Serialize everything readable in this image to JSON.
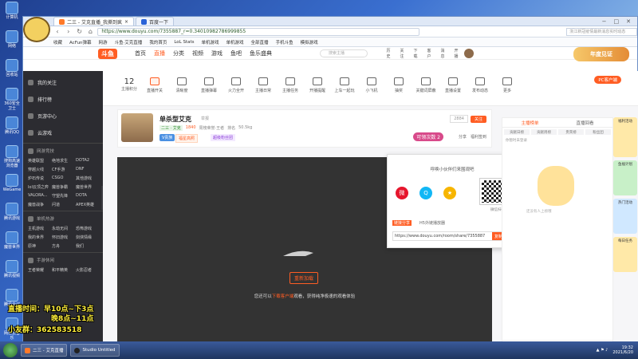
{
  "browser": {
    "tabs": [
      {
        "label": "二三 - 艾克直播_我撕到疯",
        "active": true
      },
      {
        "label": "百度一下",
        "active": false
      }
    ],
    "window_controls": [
      "−",
      "□",
      "✕"
    ],
    "url": "https://www.douyu.com/7355887_r=0.34010982786999855",
    "search_placeholder": "浙江新冠疫情最新消息实时动态",
    "bookmarks": [
      "收藏",
      "AcFun弹幕",
      "网游",
      "斗鱼·艾克直播",
      "我的首页",
      "LoL Stats",
      "单机游戏",
      "单机游戏",
      "全部直播",
      "手机斗鱼",
      "模拟游戏"
    ]
  },
  "site": {
    "logo": "斗鱼",
    "nav": [
      "首页",
      "直播",
      "分类",
      "视频",
      "游戏",
      "鱼吧",
      "鱼乐盛典"
    ],
    "active_nav": "直播",
    "search_placeholder": "搜索主播",
    "top_icons": [
      "历史",
      "关注",
      "下载",
      "客户",
      "消息",
      "开播"
    ],
    "promo": "年度见证"
  },
  "sidebar": {
    "main_items": [
      "我的关注",
      "排行榜",
      "页游中心",
      "云游戏"
    ],
    "sections": [
      {
        "title": "网游竞技",
        "items": [
          "英雄联盟",
          "绝地求生",
          "DOTA2",
          "穿越火线",
          "CF手游",
          "DNF",
          "炉石传说",
          "CSGO",
          "其他游戏",
          "lol云顶之弈",
          "魔兽争霸",
          "魔兽世界",
          "VALORA...",
          "守望先锋",
          "DOTA",
          "魔兽战争",
          "问道",
          "APEX英雄"
        ]
      },
      {
        "title": "单机热游",
        "items": [
          "主机游戏",
          "永劫无间",
          "恐怖游戏",
          "我的世界",
          "怀旧游戏",
          "剑侠情缘",
          "原神",
          "方舟",
          "我们"
        ]
      },
      {
        "title": "手游休闲",
        "items": [
          "王者荣耀",
          "和平精英",
          "火影忍者"
        ]
      }
    ]
  },
  "categories": {
    "first": {
      "num": "12",
      "label": "主播积分"
    },
    "items": [
      "直播开关",
      "清晰度",
      "直播弹幕",
      "火力全开",
      "主播日常",
      "主播任务",
      "开播提醒",
      "上车一起玩",
      "小飞机",
      "抽奖",
      "关键词屏蔽",
      "直播设置",
      "发布动态",
      "更多"
    ],
    "pc_client": "PC客户端"
  },
  "room": {
    "title": "单杀型艾克",
    "category_tag": "举报",
    "meta": [
      "二三 · 艾克",
      "1840",
      "周榜荣誉·王者",
      "排名",
      "50.5kg"
    ],
    "hot": "1840",
    "vip": "V贵族",
    "activity": "福星高照",
    "activity2": "超级粉丝团",
    "follow_count": "2884",
    "follow_label": "关注",
    "limit_label": "可领次数",
    "limit_num": "2",
    "links": [
      "分享",
      "福利签到"
    ]
  },
  "player": {
    "button": "重新加载",
    "message_pre": "您还可以",
    "message_link": "下载客户端",
    "message_post": "观看，获得纯净极速的观看体验"
  },
  "share": {
    "title": "呼唤小伙伴们来围观吧",
    "social": [
      "微博",
      "QQ",
      "QQ空间"
    ],
    "qr_label": "微信扫码分享",
    "tabs": [
      "链接分享",
      "H5外链播放器"
    ],
    "url": "https://www.douyu.com/room/share/7355887",
    "copy_button": "复制链接"
  },
  "rightpanel": {
    "tabs": [
      "主播榜单",
      "直播回看"
    ],
    "sub": [
      "贡献日榜",
      "贡献周榜",
      "贵宾榜",
      "粉丝团"
    ],
    "empty": "你暂时未登录",
    "hint": "还没有人上榜哦",
    "bottom_left": "100%",
    "bottom_right": "上"
  },
  "ads": [
    {
      "label": "福利活动",
      "color": "#ffe9a8"
    },
    {
      "label": "鱼福计划",
      "color": "#c8f0c8"
    },
    {
      "label": "热门活动",
      "color": "#d0e8ff"
    },
    {
      "label": "每日任务",
      "color": "#ffe9a8"
    }
  ],
  "overlay": {
    "line1": "直播时间：早10点~下3点",
    "line2": "晚8点~11点",
    "line3": "小友群：362583518"
  },
  "desktop_icons": [
    "计算机",
    "网络",
    "回收站",
    "360安全卫士",
    "腾讯QQ",
    "搜狗高速浏览器",
    "WeGame",
    "腾讯游戏",
    "魔兽世界",
    "腾讯视频",
    "腾讯会议",
    "网易云音乐",
    "鲁大师"
  ],
  "taskbar": {
    "tasks": [
      "二三 - 艾克直播",
      "Studio Untitled"
    ],
    "time": "19:32",
    "date": "2021/6/20"
  }
}
